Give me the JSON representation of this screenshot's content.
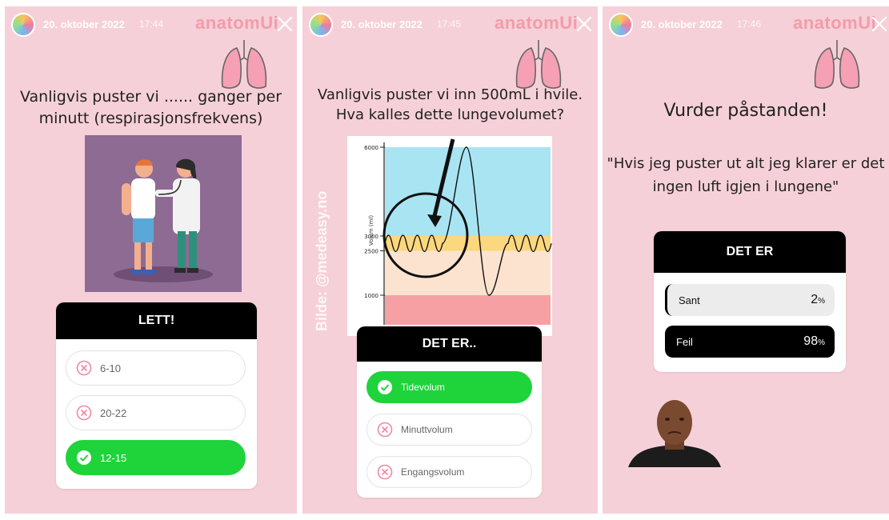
{
  "panels": [
    {
      "date": "20. oktober 2022",
      "time": "17:44",
      "brand": "anatomUi",
      "question": "Vanligvis puster vi ...... ganger per minutt (respirasjonsfrekvens)",
      "poll": {
        "title": "LETT!",
        "options": [
          {
            "label": "6-10",
            "state": "wrong"
          },
          {
            "label": "20-22",
            "state": "wrong"
          },
          {
            "label": "12-15",
            "state": "correct"
          }
        ]
      }
    },
    {
      "date": "20. oktober 2022",
      "time": "17:45",
      "brand": "anatomUi",
      "question": "Vanligvis puster vi inn 500mL i hvile. Hva kalles dette lungevolumet?",
      "image_credit": "Bilde: @medeasy.no",
      "poll": {
        "title": "DET ER..",
        "options": [
          {
            "label": "Tidevolum",
            "state": "correct"
          },
          {
            "label": "Minuttvolum",
            "state": "wrong"
          },
          {
            "label": "Engangsvolum",
            "state": "wrong"
          }
        ]
      }
    },
    {
      "date": "20. oktober 2022",
      "time": "17:46",
      "brand": "anatomUi",
      "question_title": "Vurder påstanden!",
      "statement": "\"Hvis jeg puster ut alt jeg klarer er det ingen luft igjen i lungene\"",
      "poll": {
        "title": "DET ER",
        "results": [
          {
            "label": "Sant",
            "value": "2",
            "unit": "%"
          },
          {
            "label": "Feil",
            "value": "98",
            "unit": "%"
          }
        ]
      }
    }
  ],
  "chart_data": {
    "type": "line",
    "ylabel": "Volum (ml)",
    "yticks": [
      6000,
      3000,
      2500,
      1000
    ],
    "bands": [
      {
        "from": 3000,
        "to": 6000,
        "color": "#a9e4f2"
      },
      {
        "from": 2500,
        "to": 3000,
        "color": "#fbd77e"
      },
      {
        "from": 1000,
        "to": 2500,
        "color": "#fbe3d0"
      },
      {
        "from": 0,
        "to": 1000,
        "color": "#f6a0a4"
      }
    ]
  },
  "colors": {
    "background": "#f6d0d8",
    "correct": "#1fd33b",
    "wrong": "#f08aa0",
    "brand": "#f39bab"
  }
}
